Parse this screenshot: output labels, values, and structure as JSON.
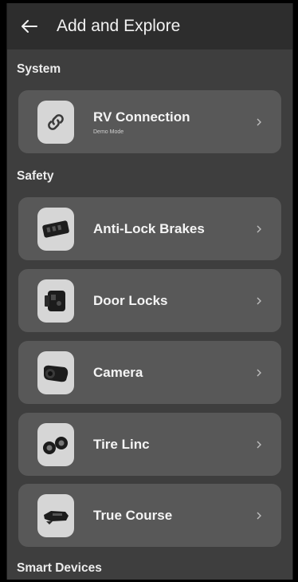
{
  "header": {
    "title": "Add and Explore",
    "back_icon": "arrow-left-icon"
  },
  "sections": {
    "system": "System",
    "safety": "Safety",
    "smart_devices": "Smart Devices"
  },
  "items": [
    {
      "label": "RV Connection",
      "sublabel": "Demo Mode",
      "icon": "link-icon"
    },
    {
      "label": "Anti-Lock Brakes",
      "icon": "brake-controller-icon"
    },
    {
      "label": "Door Locks",
      "icon": "door-lock-icon"
    },
    {
      "label": "Camera",
      "icon": "camera-icon"
    },
    {
      "label": "Tire Linc",
      "icon": "tire-sensors-icon"
    },
    {
      "label": "True Course",
      "icon": "sway-control-icon"
    }
  ]
}
